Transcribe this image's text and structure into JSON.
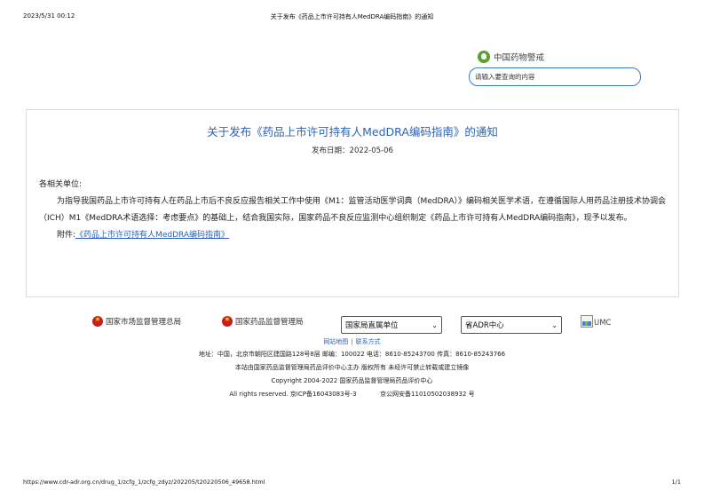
{
  "print_header": {
    "datetime": "2023/5/31 00:12",
    "title": "关于发布《药品上市许可持有人MedDRA编码指南》的通知"
  },
  "brand": {
    "icon": "leaf-logo-icon",
    "name": "中国药物警戒"
  },
  "search": {
    "placeholder": "请输入要查询的内容"
  },
  "article": {
    "title": "关于发布《药品上市许可持有人MedDRA编码指南》的通知",
    "date": "发布日期：2022-05-06",
    "salutation": "各相关单位:",
    "paragraph": "为指导我国药品上市许可持有人在药品上市后不良反应报告相关工作中使用《M1：监管活动医学词典（MedDRA）》编码相关医学术语，在遵循国际人用药品注册技术协调会（ICH）M1《MedDRA术语选择：考虑要点》的基础上，结合我国实际，国家药品不良反应监测中心组织制定《药品上市许可持有人MedDRA编码指南》，现予以发布。",
    "attachment_label": "附件:",
    "attachment_link": "《药品上市许可持有人MedDRA编码指南》"
  },
  "footer_links": {
    "samr": "国家市场监督管理总局",
    "nmpa": "国家药品监督管理局",
    "select_direct": "国家局直属单位",
    "select_adr": "省ADR中心",
    "umc": "UMC"
  },
  "footer": {
    "sitemap": "网站地图",
    "separator": "|",
    "contact": "联系方式",
    "address": "地址：中国，北京市朝阳区建国路128号8层  邮编：100022  电话：8610-85243700  传真：8610-85243766",
    "sponsor": "本站由国家药品监督管理局药品评价中心主办 版权所有 未经许可禁止转载或建立镜像",
    "copyright": "Copyright 2004-2022 国家药品监督管理局药品评价中心",
    "icp": "All rights reserved. 京ICP备16043083号-3",
    "police": "京公网安备11010502038932 号"
  },
  "print_footer": {
    "url": "https://www.cdr-adr.org.cn/drug_1/zcfg_1/zcfg_zdyz/202205/t20220506_49658.html",
    "page": "1/1"
  },
  "colors": {
    "link_blue": "#2c62b6",
    "emblem_red": "#c81e1e",
    "brand_green": "#5aa02c"
  }
}
